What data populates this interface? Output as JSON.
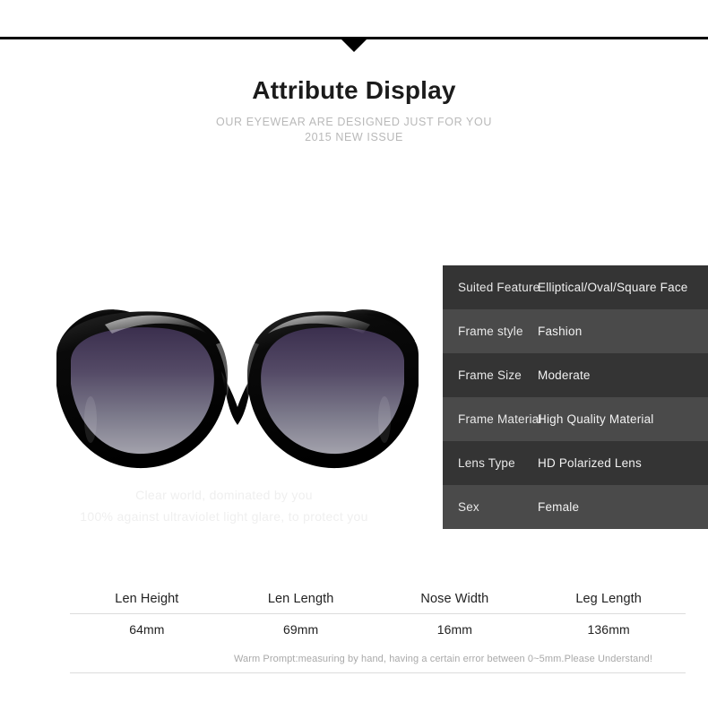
{
  "banner": {
    "arrow_icon": "triangle-down-icon"
  },
  "header": {
    "title": "Attribute Display",
    "subtitle_line_1": "OUR EYEWEAR ARE DESIGNED JUST FOR YOU",
    "subtitle_line_2": "2015 NEW ISSUE"
  },
  "product": {
    "image_name": "black-sunglasses-photo",
    "caption_line_1": "Clear world, dominated by you",
    "caption_line_2": "100% against ultraviolet light glare, to protect you",
    "frame_color": "#0d0d0d",
    "lens_gradient_top": "#413553",
    "lens_gradient_bottom": "#9b9aa4"
  },
  "attributes": {
    "row_color_odd": "#343434",
    "row_color_even": "#4a4a4a",
    "rows": [
      {
        "label": "Suited Feature",
        "value": "Elliptical/Oval/Square Face"
      },
      {
        "label": "Frame style",
        "value": "Fashion"
      },
      {
        "label": "Frame Size",
        "value": "Moderate"
      },
      {
        "label": "Frame Material",
        "value": "High Quality Material"
      },
      {
        "label": "Lens Type",
        "value": "HD Polarized Lens"
      },
      {
        "label": "Sex",
        "value": "Female"
      }
    ]
  },
  "measurements": {
    "headers": [
      "Len Height",
      "Len Length",
      "Nose Width",
      "Leg Length"
    ],
    "values": [
      "64mm",
      "69mm",
      "16mm",
      "136mm"
    ],
    "warm_prompt": "Warm Prompt:measuring by hand, having a certain error between 0~5mm.Please Understand!"
  }
}
